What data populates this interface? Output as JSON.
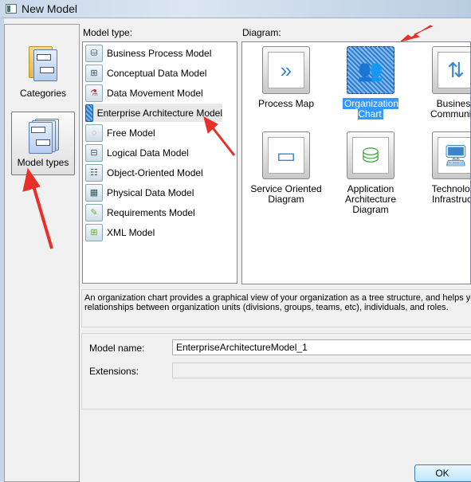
{
  "window": {
    "title": "New Model"
  },
  "left_panel": {
    "items": [
      {
        "label": "Categories",
        "icon": "categories-icon"
      },
      {
        "label": "Model types",
        "icon": "model-types-icon",
        "selected": true
      }
    ]
  },
  "model_type": {
    "label": "Model type:",
    "selected": "Enterprise Architecture Model",
    "items": [
      {
        "label": "Business Process Model",
        "icon": "business-process-icon"
      },
      {
        "label": "Conceptual Data Model",
        "icon": "conceptual-data-icon"
      },
      {
        "label": "Data Movement Model",
        "icon": "data-movement-icon"
      },
      {
        "label": "Enterprise Architecture Model",
        "icon": "enterprise-architecture-icon"
      },
      {
        "label": "Free Model",
        "icon": "free-model-icon"
      },
      {
        "label": "Logical Data Model",
        "icon": "logical-data-icon"
      },
      {
        "label": "Object-Oriented Model",
        "icon": "object-oriented-icon"
      },
      {
        "label": "Physical Data Model",
        "icon": "physical-data-icon"
      },
      {
        "label": "Requirements Model",
        "icon": "requirements-icon"
      },
      {
        "label": "XML Model",
        "icon": "xml-model-icon"
      }
    ]
  },
  "diagram": {
    "label": "Diagram:",
    "selected": "Organization Chart",
    "items": [
      {
        "label": "Process Map",
        "icon": "process-map-icon"
      },
      {
        "label": "Organization Chart",
        "icon": "org-chart-icon"
      },
      {
        "label": "Business Communica",
        "icon": "business-communication-icon",
        "l1": "Business",
        "l2": "Communica"
      },
      {
        "label": "Service Oriented Diagram",
        "l1": "Service Oriented",
        "l2": "Diagram",
        "icon": "service-oriented-icon"
      },
      {
        "label": "Application Architecture Diagram",
        "l1": "Application",
        "l2": "Architecture Diagram",
        "icon": "application-architecture-icon"
      },
      {
        "label": "Technology Infrastructu",
        "l1": "Technolog",
        "l2": "Infrastructu",
        "icon": "technology-infrastructure-icon"
      }
    ]
  },
  "description": {
    "line1": "An organization chart provides a graphical view of your organization as a tree structure, and helps you a",
    "line2": "relationships between organization units (divisions, groups, teams, etc), individuals, and roles."
  },
  "form": {
    "model_name_label": "Model name:",
    "model_name_value": "EnterpriseArchitectureModel_1",
    "extensions_label": "Extensions:",
    "extensions_value": ""
  },
  "buttons": {
    "ok": "OK"
  },
  "annotation_color": "#e8302a"
}
